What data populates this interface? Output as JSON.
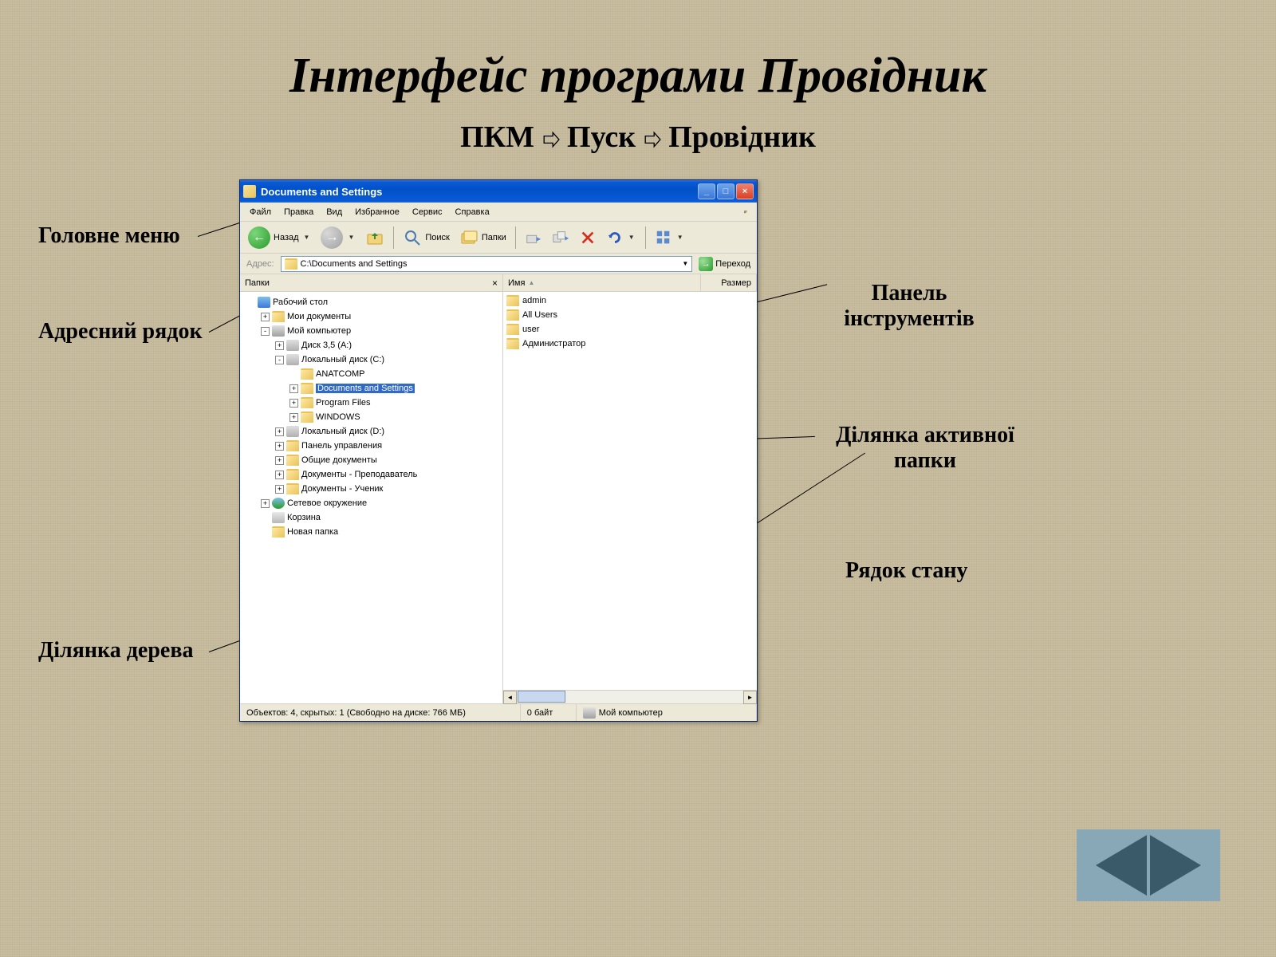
{
  "slide": {
    "title": "Інтерфейс програми Провідник",
    "subtitle_parts": [
      "ПКМ ",
      " Пуск",
      " Провідник"
    ]
  },
  "callouts": {
    "main_menu": "Головне меню",
    "toolbar": "Панель інструментів",
    "address_bar": "Адресний рядок",
    "active_folder_area": "Ділянка активної папки",
    "tree_area": "Ділянка дерева",
    "status_bar": "Рядок стану"
  },
  "window": {
    "title": "Documents and Settings",
    "menu": [
      "Файл",
      "Правка",
      "Вид",
      "Избранное",
      "Сервис",
      "Справка"
    ],
    "toolbar": {
      "back": "Назад",
      "search": "Поиск",
      "folders": "Папки"
    },
    "addressbar": {
      "label": "Адрес:",
      "value": "C:\\Documents and Settings",
      "go": "Переход"
    },
    "tree": {
      "header": "Папки",
      "items": [
        {
          "indent": 0,
          "exp": "",
          "icon": "desktop",
          "label": "Рабочий стол"
        },
        {
          "indent": 1,
          "exp": "+",
          "icon": "folder",
          "label": "Мои документы"
        },
        {
          "indent": 1,
          "exp": "-",
          "icon": "computer",
          "label": "Мой компьютер"
        },
        {
          "indent": 2,
          "exp": "+",
          "icon": "drive",
          "label": "Диск 3,5 (A:)"
        },
        {
          "indent": 2,
          "exp": "-",
          "icon": "drive",
          "label": "Локальный диск (C:)"
        },
        {
          "indent": 3,
          "exp": "",
          "icon": "folder",
          "label": "ANATCOMP"
        },
        {
          "indent": 3,
          "exp": "+",
          "icon": "folder",
          "label": "Documents and Settings",
          "selected": true
        },
        {
          "indent": 3,
          "exp": "+",
          "icon": "folder",
          "label": "Program Files"
        },
        {
          "indent": 3,
          "exp": "+",
          "icon": "folder",
          "label": "WINDOWS"
        },
        {
          "indent": 2,
          "exp": "+",
          "icon": "drive",
          "label": "Локальный диск (D:)"
        },
        {
          "indent": 2,
          "exp": "+",
          "icon": "folder",
          "label": "Панель управления"
        },
        {
          "indent": 2,
          "exp": "+",
          "icon": "folder",
          "label": "Общие документы"
        },
        {
          "indent": 2,
          "exp": "+",
          "icon": "folder",
          "label": "Документы - Преподаватель"
        },
        {
          "indent": 2,
          "exp": "+",
          "icon": "folder",
          "label": "Документы - Ученик"
        },
        {
          "indent": 1,
          "exp": "+",
          "icon": "network",
          "label": "Сетевое окружение"
        },
        {
          "indent": 1,
          "exp": "",
          "icon": "bin",
          "label": "Корзина"
        },
        {
          "indent": 1,
          "exp": "",
          "icon": "folder",
          "label": "Новая папка"
        }
      ]
    },
    "list": {
      "columns": {
        "name": "Имя",
        "size": "Размер"
      },
      "items": [
        "admin",
        "All Users",
        "user",
        "Администратор"
      ]
    },
    "statusbar": {
      "objects": "Объектов: 4, скрытых: 1 (Свободно на диске: 766 МБ)",
      "bytes": "0 байт",
      "location": "Мой компьютер"
    }
  }
}
